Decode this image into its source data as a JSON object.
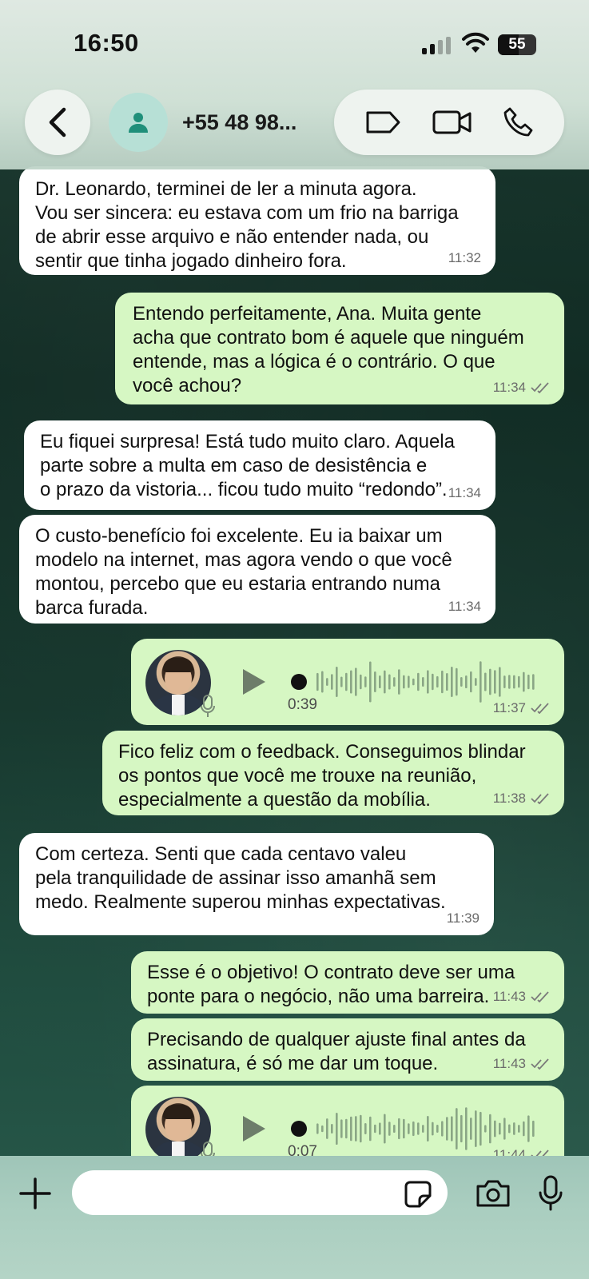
{
  "status_bar": {
    "time": "16:50",
    "battery": "55"
  },
  "header": {
    "contact": "+55 48 98...",
    "back_icon": "chevron-left-icon",
    "actions": [
      "label-icon",
      "video-call-icon",
      "voice-call-icon"
    ]
  },
  "messages": [
    {
      "dir": "in",
      "text": "Dr. Leonardo, terminei de ler a minuta agora.\nVou ser sincera: eu estava com um frio na barriga\nde abrir esse arquivo e não entender nada, ou\nsentir que tinha jogado dinheiro fora.",
      "time": "11:32"
    },
    {
      "dir": "out",
      "text": "Entendo perfeitamente, Ana. Muita gente\nacha que contrato bom é aquele que ninguém\nentende, mas a lógica é o contrário. O que\nvocê achou?",
      "time": "11:34"
    },
    {
      "dir": "in",
      "text": "Eu fiquei surpresa! Está tudo muito claro. Aquela\nparte sobre a multa em caso de desistência e\no prazo da vistoria... ficou tudo muito “redondo”.",
      "time": "11:34"
    },
    {
      "dir": "in",
      "text": "O custo-benefício foi excelente. Eu ia baixar um\nmodelo na internet, mas agora vendo o que você\nmontou, percebo que eu estaria entrando numa\nbarca furada.",
      "time": "11:34"
    },
    {
      "dir": "out",
      "type": "voice",
      "duration": "0:39",
      "time": "11:37"
    },
    {
      "dir": "out",
      "text": "Fico feliz com o feedback. Conseguimos blindar\nos pontos que você me trouxe na reunião,\nespecialmente a questão da mobília.",
      "time": "11:38"
    },
    {
      "dir": "in",
      "text": "Com certeza. Senti que cada centavo valeu\npela tranquilidade de assinar isso amanhã sem\nmedo. Realmente superou minhas expectativas.",
      "time": "11:39"
    },
    {
      "dir": "out",
      "text": "Esse é o objetivo! O contrato deve ser uma\nponte para o negócio, não uma barreira.",
      "time": "11:43"
    },
    {
      "dir": "out",
      "text": "Precisando de qualquer ajuste final antes da\nassinatura, é só me dar um toque.",
      "time": "11:43"
    },
    {
      "dir": "out",
      "type": "voice",
      "duration": "0:07",
      "time": "11:44"
    }
  ],
  "input": {
    "placeholder": ""
  }
}
